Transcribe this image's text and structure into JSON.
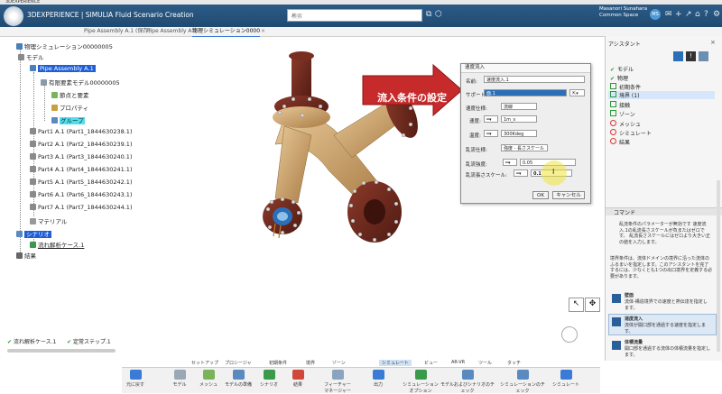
{
  "window_title": "3DEXPERIENCE",
  "app": {
    "brand": "3DEXPERIENCE | SIMULIA Fluid Scenario Creation",
    "search_placeholder": "検索",
    "user_name": "Masanori Sunahara",
    "user_space": "Common Space",
    "avatar_initials": "MS"
  },
  "tabs": [
    {
      "label": "Pipe Assembly A.1 (保存)"
    },
    {
      "label": "Pipe Assembly A.1"
    },
    {
      "label": "物理シミュレーション0000"
    }
  ],
  "tree": {
    "root": "物理シミュレーション00000005",
    "model": "モデル",
    "assembly": "Pipe Assembly A.1",
    "fe_model": "有限要素モデル00000005",
    "nodes_elements": "節点と要素",
    "properties": "プロパティ",
    "groups": "グループ",
    "parts": [
      "Part1 A.1 (Part1_1844630238.1)",
      "Part2 A.1 (Part2_1844630239.1)",
      "Part3 A.1 (Part3_1844630240.1)",
      "Part4 A.1 (Part4_1844630241.1)",
      "Part5 A.1 (Part5_1844630242.1)",
      "Part6 A.1 (Part6_1844630243.1)",
      "Part7 A.1 (Part7_1844630244.1)"
    ],
    "materials": "マテリアル",
    "scenario": "シナリオ",
    "flow_case": "流れ解析ケース.1",
    "results": "結果"
  },
  "status_bar": {
    "case": "流れ解析ケース.1",
    "step": "定常ステップ.1"
  },
  "callout": {
    "text": "流入条件の設定"
  },
  "dialog": {
    "title": "速度流入",
    "name_label": "名前:",
    "name_value": "速度流入.1",
    "support_label": "サポート:",
    "support_value": "面.1",
    "velocity_spec_label": "速度仕様:",
    "velocity_spec_value": "流線",
    "velocity_label": "速度:",
    "velocity_value": "1m_s",
    "temperature_label": "温度:",
    "temperature_value": "300Kdeg",
    "turbulence_spec_label": "乱流仕様:",
    "turbulence_spec_value": "強度 - 長さスケール",
    "turbulence_intensity_label": "乱流強度:",
    "turbulence_intensity_value": "0.05",
    "turbulence_length_label": "乱流長さスケール:",
    "turbulence_length_value": "0.1",
    "ok_label": "OK",
    "cancel_label": "キャンセル"
  },
  "assistant": {
    "title": "アシスタント",
    "items": [
      {
        "label": "モデル",
        "status": "done"
      },
      {
        "label": "物理",
        "status": "done"
      },
      {
        "label": "初期条件",
        "status": "todo"
      },
      {
        "label": "境界 (1)",
        "status": "todo",
        "selected": true
      },
      {
        "label": "接触",
        "status": "todo"
      },
      {
        "label": "ゾーン",
        "status": "todo"
      },
      {
        "label": "メッシュ",
        "status": "blocked"
      },
      {
        "label": "シミュレート",
        "status": "blocked"
      },
      {
        "label": "結果",
        "status": "blocked"
      }
    ]
  },
  "command": {
    "title": "コマンド",
    "text": "乱流条件のパラメーターが無効です 速度流入.1の乱流長さスケールが負またはゼロです。 乱流長さスケールにはゼロより大きい正の値を入力します。",
    "text2": "境界条件は、流体ドメインの境界に沿った流体のふるまいを指定します。このアシスタントを完了するには、少なくとも1つの出口境界を定義する必要があります。",
    "tools": [
      {
        "name": "壁面",
        "desc": "流体-構造境界での速度と熱伝達を指定します。"
      },
      {
        "name": "速度流入",
        "desc": "流体が開口部を通過する速度を指定します。"
      },
      {
        "name": "体積流量",
        "desc": "開口部を通過する流体の体積流量を指定します。"
      }
    ]
  },
  "ribbon": {
    "tabs": [
      "セットアップ",
      "プロシージャ",
      "初期条件",
      "境界",
      "ゾーン",
      "シミュレート",
      "ビュー",
      "AR-VR",
      "ツール",
      "タッチ"
    ],
    "buttons": [
      "元に戻す",
      "モデル",
      "メッシュ",
      "モデルの準備",
      "シナリオ",
      "結果",
      "フィーチャー マネージャー",
      "出力",
      "シミュレーション オプション",
      "モデルおよびシナリオのチェック",
      "シミュレーションのチェック",
      "シミュレート"
    ]
  }
}
